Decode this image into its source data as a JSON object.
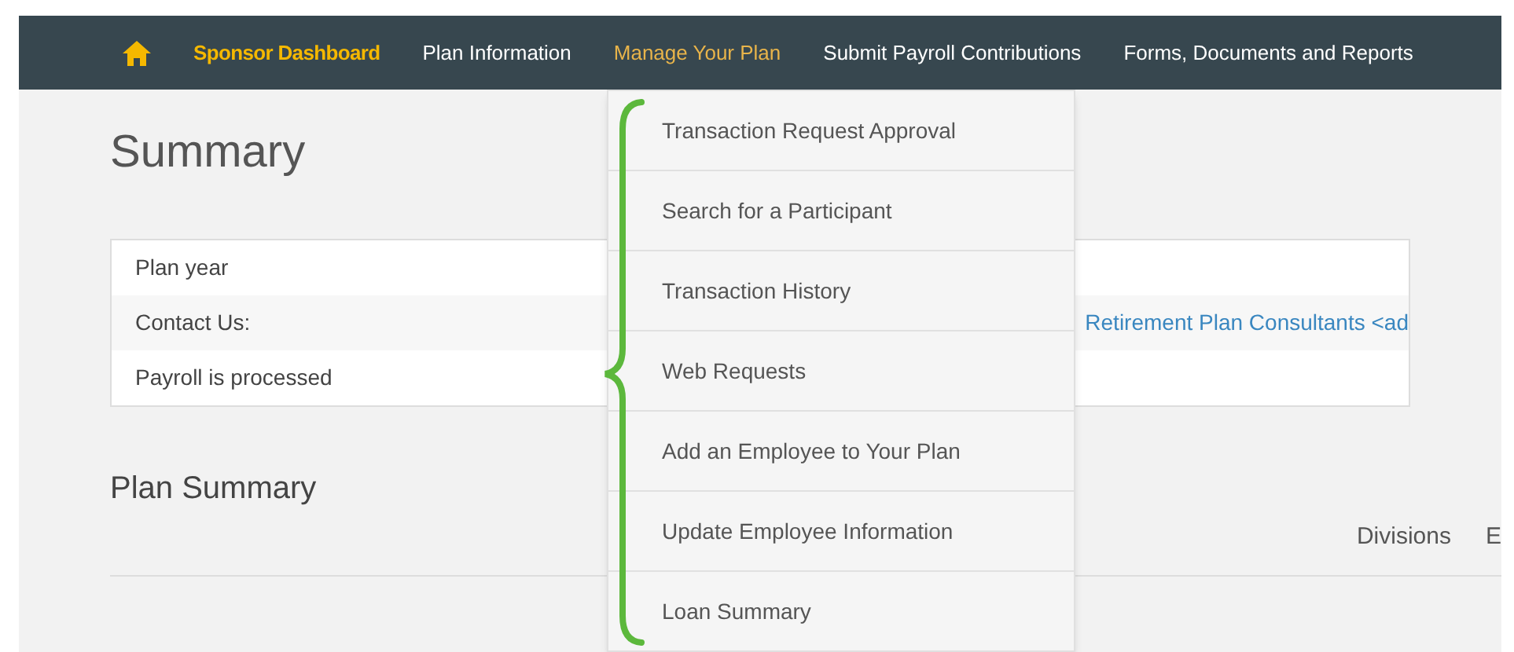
{
  "nav": {
    "items": [
      {
        "label": "Sponsor Dashboard",
        "selected": true,
        "expanded": false
      },
      {
        "label": "Plan Information",
        "selected": false,
        "expanded": false
      },
      {
        "label": "Manage Your Plan",
        "selected": false,
        "expanded": true
      },
      {
        "label": "Submit Payroll Contributions",
        "selected": false,
        "expanded": false
      },
      {
        "label": "Forms, Documents and Reports",
        "selected": false,
        "expanded": false
      }
    ]
  },
  "dropdown": {
    "items": [
      "Transaction Request Approval",
      "Search for a Participant",
      "Transaction History",
      "Web Requests",
      "Add an Employee to Your Plan",
      "Update Employee Information",
      "Loan Summary"
    ]
  },
  "page": {
    "title": "Summary",
    "info_rows": [
      {
        "label": "Plan year"
      },
      {
        "label": "Contact Us:",
        "link": "Retirement Plan Consultants <ad"
      },
      {
        "label": "Payroll is processed"
      }
    ],
    "section_title": "Plan Summary",
    "tabs": [
      "Divisions",
      "E"
    ]
  }
}
